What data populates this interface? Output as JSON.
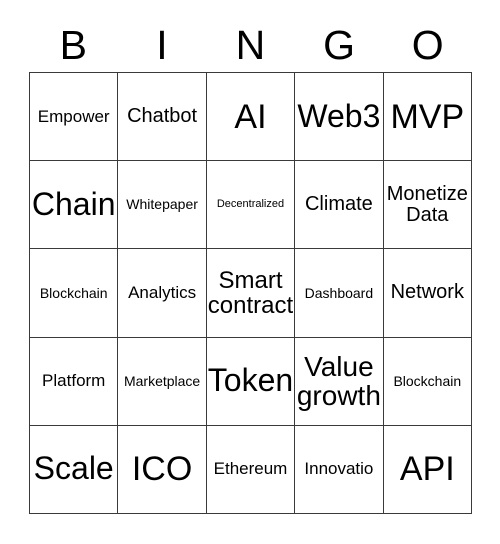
{
  "card": {
    "title": "Bingo Card",
    "background_color": "#ffffff",
    "text_color": "#000000",
    "border_color": "#3a3a3a"
  },
  "header": {
    "letters": [
      "B",
      "I",
      "N",
      "G",
      "O"
    ]
  },
  "grid": {
    "columns": 5,
    "rows": 5,
    "cells": [
      {
        "text": "Empower",
        "size": "xs",
        "clipped": false
      },
      {
        "text": "Chatbot",
        "size": "s",
        "clipped": false
      },
      {
        "text": "AI",
        "size": "xxl",
        "clipped": false
      },
      {
        "text": "Web3",
        "size": "xl",
        "clipped": false
      },
      {
        "text": "MVP",
        "size": "xxl",
        "clipped": false
      },
      {
        "text": "Chain",
        "size": "xl",
        "clipped": false
      },
      {
        "text": "Whitepaper",
        "size": "xxs",
        "clipped": false
      },
      {
        "text": "Decentralized",
        "size": "tiny",
        "clipped": false
      },
      {
        "text": "Climate",
        "size": "s",
        "clipped": false
      },
      {
        "text": "Monetize Data",
        "size": "s",
        "clipped": false
      },
      {
        "text": "Blockchain",
        "size": "xxs",
        "clipped": false
      },
      {
        "text": "Analytics",
        "size": "xs",
        "clipped": false
      },
      {
        "text": "Smart contract",
        "size": "m",
        "clipped": false
      },
      {
        "text": "Dashboard",
        "size": "xxs",
        "clipped": false
      },
      {
        "text": "Network",
        "size": "s",
        "clipped": false
      },
      {
        "text": "Platform",
        "size": "xs",
        "clipped": false
      },
      {
        "text": "Marketplace",
        "size": "xxs",
        "clipped": false
      },
      {
        "text": "Token",
        "size": "xl",
        "clipped": false
      },
      {
        "text": "Value growth",
        "size": "l",
        "clipped": false
      },
      {
        "text": "Blockchain",
        "size": "xxs",
        "clipped": false
      },
      {
        "text": "Scale",
        "size": "xl",
        "clipped": false
      },
      {
        "text": "ICO",
        "size": "xxl",
        "clipped": false
      },
      {
        "text": "Ethereum",
        "size": "xs",
        "clipped": false
      },
      {
        "text": "Innovatio",
        "size": "xs",
        "clipped": true
      },
      {
        "text": "API",
        "size": "xxl",
        "clipped": false
      }
    ]
  }
}
